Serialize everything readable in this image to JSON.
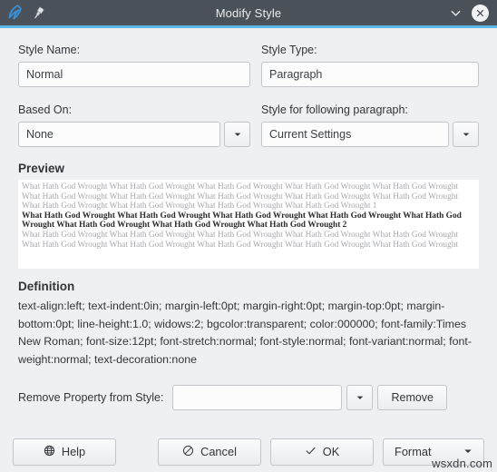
{
  "titlebar": {
    "title": "Modify Style",
    "logo_icon": "app-logo-icon",
    "pin_icon": "pin-icon",
    "chevron_icon": "chevron-down-icon",
    "close_icon": "close-icon",
    "bg_color": "#4a5159",
    "accent_color": "#5eb4e8"
  },
  "fields": {
    "style_name_label": "Style Name:",
    "style_name_value": "Normal",
    "style_type_label": "Style Type:",
    "style_type_value": "Paragraph",
    "based_on_label": "Based On:",
    "based_on_value": "None",
    "following_label": "Style for following paragraph:",
    "following_value": "Current Settings"
  },
  "preview": {
    "heading": "Preview",
    "para_before": "What Hath God Wrought  What Hath God Wrought  What Hath God Wrought  What Hath God Wrought  What Hath God Wrought  What Hath God Wrought  What Hath God Wrought  What Hath God Wrought  What Hath God Wrought  What Hath God Wrought  What Hath God Wrought  What Hath God Wrought  What Hath God Wrought  What Hath God Wrought   1",
    "para_active": "What Hath God Wrought  What Hath God Wrought  What Hath God Wrought  What Hath God Wrought  What Hath God Wrought  What Hath God Wrought  What Hath God Wrought  What Hath God Wrought   2",
    "para_after": "What Hath God Wrought  What Hath God Wrought  What Hath God Wrought  What Hath God Wrought  What Hath God Wrought  What Hath God Wrought  What Hath God Wrought  What Hath God Wrought  What Hath God Wrought  What Hath God Wrought"
  },
  "definition": {
    "heading": "Definition",
    "text": "text-align:left; text-indent:0in; margin-left:0pt; margin-right:0pt; margin-top:0pt; margin-bottom:0pt; line-height:1.0; widows:2; bgcolor:transparent; color:000000; font-family:Times New Roman; font-size:12pt; font-stretch:normal; font-style:normal; font-variant:normal; font-weight:normal; text-decoration:none"
  },
  "remove": {
    "label": "Remove Property from Style:",
    "value": "",
    "placeholder": "",
    "button_label": "Remove",
    "dropdown_icon": "chevron-down-icon"
  },
  "buttons": {
    "help_label": "Help",
    "help_icon": "help-icon",
    "cancel_label": "Cancel",
    "cancel_icon": "cancel-icon",
    "ok_label": "OK",
    "ok_icon": "check-icon",
    "format_label": "Format",
    "format_icon": "chevron-down-icon"
  },
  "watermark": {
    "text": "wsxdn.com"
  }
}
